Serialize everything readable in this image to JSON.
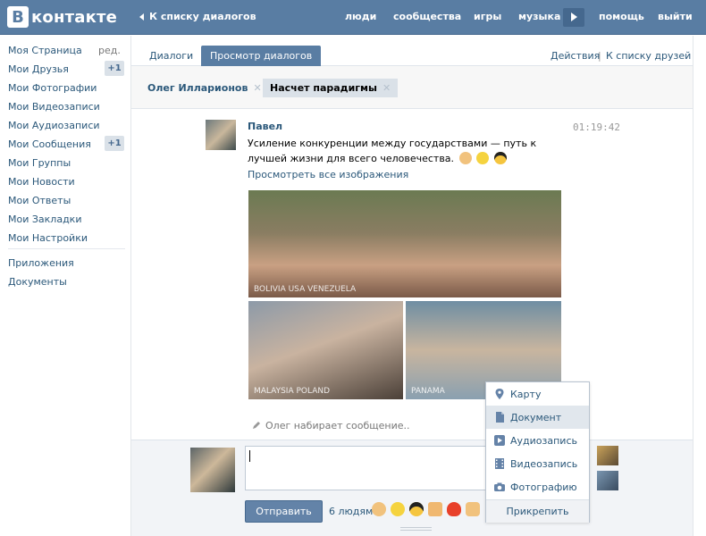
{
  "header": {
    "logo_letter": "В",
    "logo_text": "контакте",
    "back_link": "К списку диалогов",
    "nav": [
      "люди",
      "сообщества",
      "игры",
      "музыка",
      "помощь",
      "выйти"
    ]
  },
  "sidebar": {
    "items": [
      {
        "label": "Моя Страница"
      },
      {
        "label": "Мои Друзья"
      },
      {
        "label": "Мои Фотографии"
      },
      {
        "label": "Мои Видеозаписи"
      },
      {
        "label": "Мои Аудиозаписи"
      },
      {
        "label": "Мои Сообщения"
      },
      {
        "label": "Мои Группы"
      },
      {
        "label": "Мои Новости"
      },
      {
        "label": "Мои Ответы"
      },
      {
        "label": "Мои Закладки"
      },
      {
        "label": "Мои Настройки"
      },
      {
        "label": "Приложения"
      },
      {
        "label": "Документы"
      }
    ],
    "edit": "ред.",
    "friends_badge": "+1",
    "messages_badge": "+1"
  },
  "tabs": {
    "dialogs": "Диалоги",
    "view_dialogs": "Просмотр диалогов",
    "actions": "Действия",
    "separator": "|",
    "to_friends": "К списку друзей"
  },
  "chips": {
    "oleg": "Олег Илларионов",
    "paradigm": "Насчет парадигмы",
    "close": "✕"
  },
  "message": {
    "author": "Павел",
    "time": "01:19:42",
    "text": "Усиление конкуренции между государствами — путь к лучшей жизни для всего человечества.",
    "view_all_images": "Просмотреть все изображения"
  },
  "photos": {
    "main_caption": "BOLIVIA   USA   VENEZUELA",
    "left_caption": "MALAYSIA   POLAND",
    "right_caption": "PANAMA"
  },
  "typing": "Олег набирает сообщение..",
  "compose": {
    "send_label": "Отправить",
    "likes_text": "6 людям"
  },
  "attach_menu": {
    "items": [
      {
        "label": "Карту",
        "icon": "map-pin-icon"
      },
      {
        "label": "Документ",
        "icon": "document-icon"
      },
      {
        "label": "Аудиозапись",
        "icon": "audio-icon"
      },
      {
        "label": "Видеозапись",
        "icon": "video-icon"
      },
      {
        "label": "Фотографию",
        "icon": "camera-icon"
      }
    ],
    "footer": "Прикрепить"
  },
  "colors": {
    "brand": "#597da3",
    "link": "#2b587a",
    "badge_bg": "#dae1e8"
  }
}
